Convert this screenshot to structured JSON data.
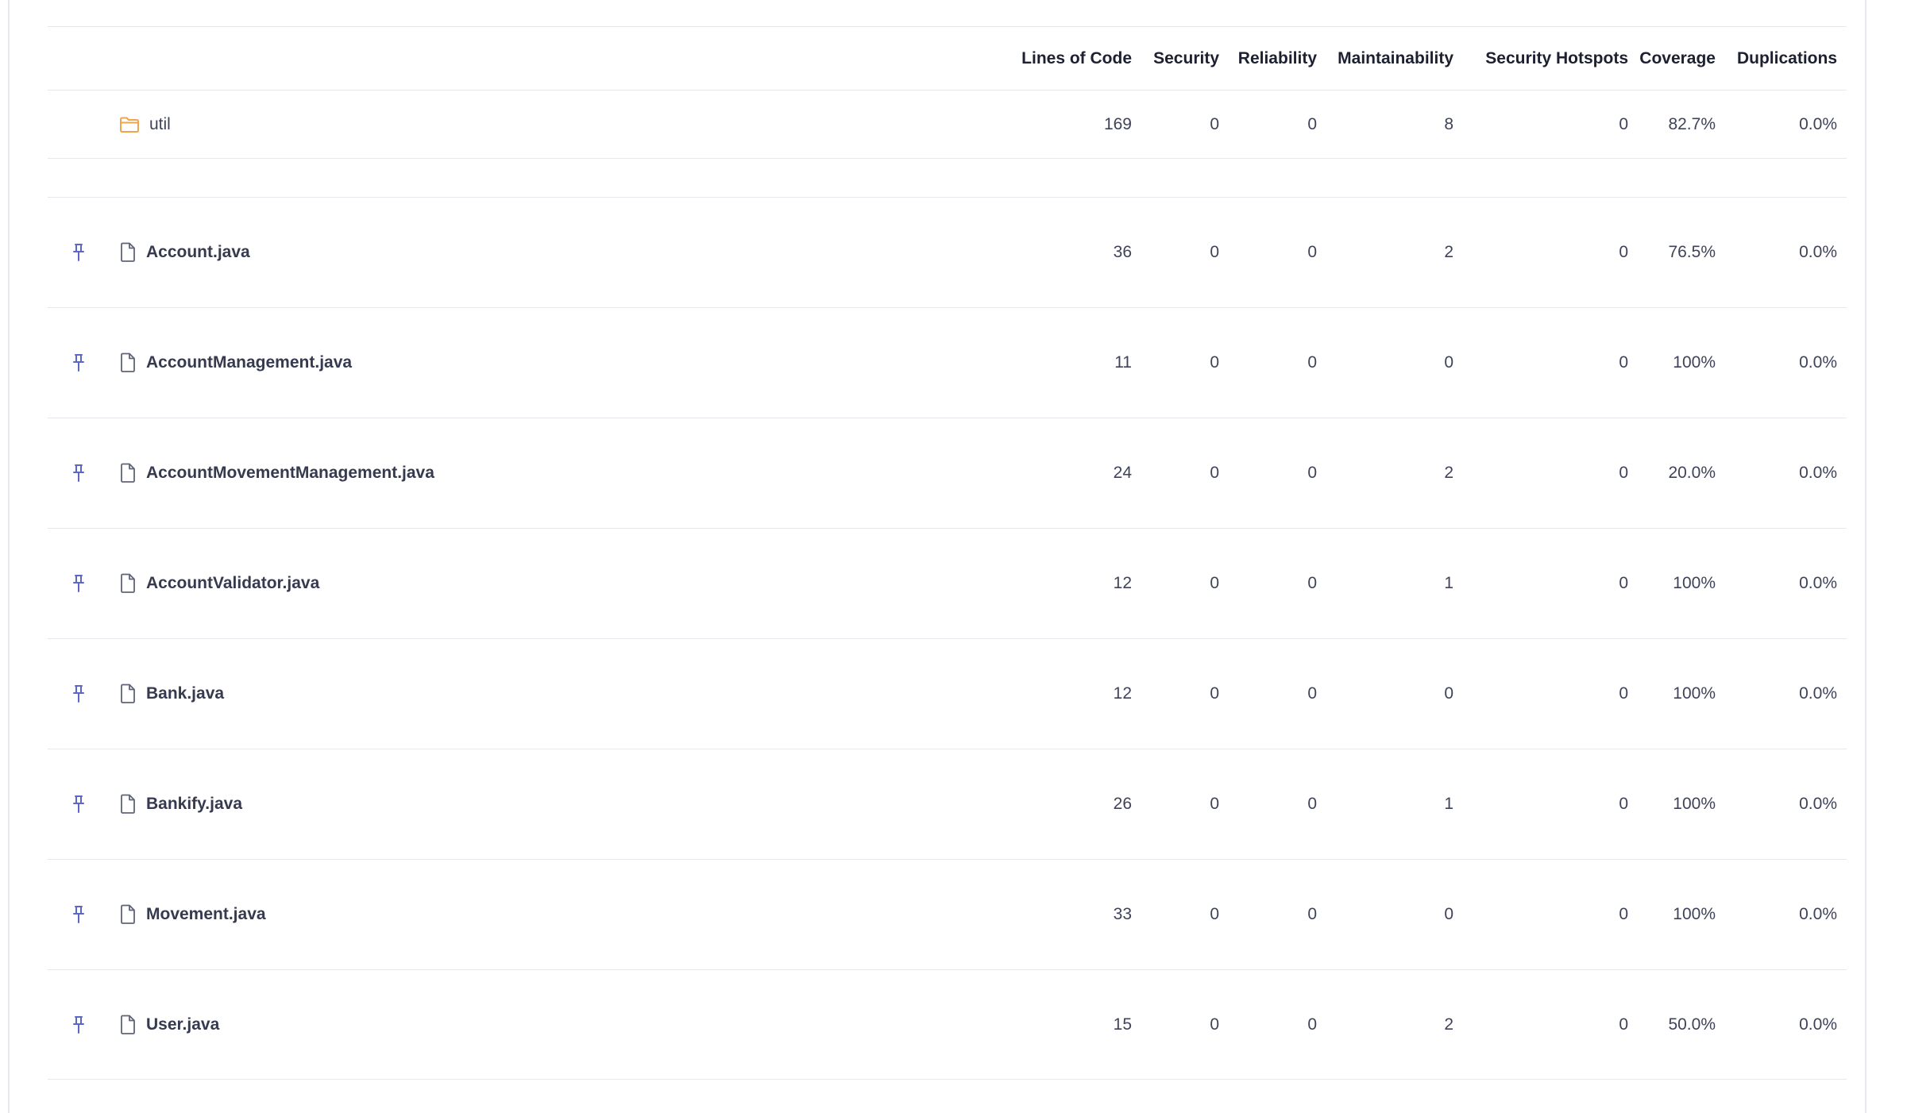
{
  "columns": {
    "lines_of_code": "Lines of Code",
    "security": "Security",
    "reliability": "Reliability",
    "maintainability": "Maintainability",
    "security_hotspots": "Security Hotspots",
    "coverage": "Coverage",
    "duplications": "Duplications"
  },
  "folder": {
    "name": "util",
    "lines_of_code": "169",
    "security": "0",
    "reliability": "0",
    "maintainability": "8",
    "security_hotspots": "0",
    "coverage": "82.7%",
    "duplications": "0.0%"
  },
  "files": [
    {
      "name": "Account.java",
      "lines_of_code": "36",
      "security": "0",
      "reliability": "0",
      "maintainability": "2",
      "security_hotspots": "0",
      "coverage": "76.5%",
      "duplications": "0.0%"
    },
    {
      "name": "AccountManagement.java",
      "lines_of_code": "11",
      "security": "0",
      "reliability": "0",
      "maintainability": "0",
      "security_hotspots": "0",
      "coverage": "100%",
      "duplications": "0.0%"
    },
    {
      "name": "AccountMovementManagement.java",
      "lines_of_code": "24",
      "security": "0",
      "reliability": "0",
      "maintainability": "2",
      "security_hotspots": "0",
      "coverage": "20.0%",
      "duplications": "0.0%"
    },
    {
      "name": "AccountValidator.java",
      "lines_of_code": "12",
      "security": "0",
      "reliability": "0",
      "maintainability": "1",
      "security_hotspots": "0",
      "coverage": "100%",
      "duplications": "0.0%"
    },
    {
      "name": "Bank.java",
      "lines_of_code": "12",
      "security": "0",
      "reliability": "0",
      "maintainability": "0",
      "security_hotspots": "0",
      "coverage": "100%",
      "duplications": "0.0%"
    },
    {
      "name": "Bankify.java",
      "lines_of_code": "26",
      "security": "0",
      "reliability": "0",
      "maintainability": "1",
      "security_hotspots": "0",
      "coverage": "100%",
      "duplications": "0.0%"
    },
    {
      "name": "Movement.java",
      "lines_of_code": "33",
      "security": "0",
      "reliability": "0",
      "maintainability": "0",
      "security_hotspots": "0",
      "coverage": "100%",
      "duplications": "0.0%"
    },
    {
      "name": "User.java",
      "lines_of_code": "15",
      "security": "0",
      "reliability": "0",
      "maintainability": "2",
      "security_hotspots": "0",
      "coverage": "50.0%",
      "duplications": "0.0%"
    }
  ],
  "colors": {
    "pin_icon": "#5a67c6",
    "file_icon": "#5f6577",
    "folder_icon": "#f0a44b",
    "border": "#e6e8ee"
  },
  "icons": {
    "pin": "pin-icon",
    "file": "file-icon",
    "folder": "folder-icon"
  }
}
